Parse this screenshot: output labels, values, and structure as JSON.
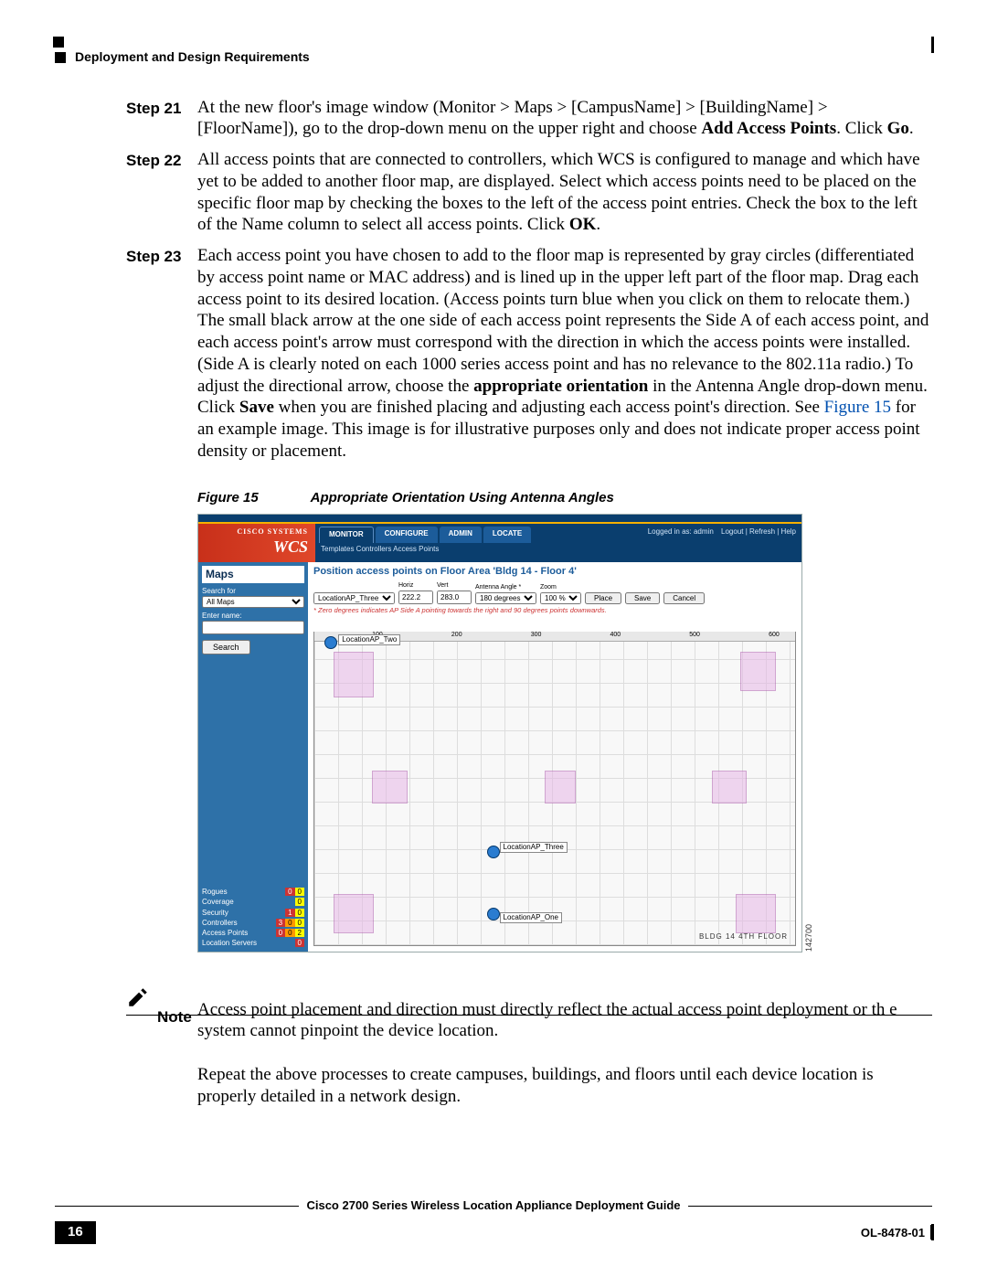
{
  "header": {
    "section": "Deployment and Design Requirements"
  },
  "steps": [
    {
      "label": "Step 21",
      "body_html": "At the new floor's image window (Monitor > Maps > [CampusName] > [BuildingName] > [FloorName]), go to the drop-down menu on the upper right and choose <b class='sans'>Add Access Points</b>. Click <b class='sans'>Go</b>."
    },
    {
      "label": "Step 22",
      "body_html": "All access points that are connected to controllers, which WCS is configured to manage and which have yet to be added to another floor map, are displayed. Select which access points need to be placed on the specific floor map by checking the boxes to the left of the access point entries. Check the box to the left of the Name column to select all access points. Click <b class='sans'>OK</b>."
    },
    {
      "label": "Step 23",
      "body_html": "Each access point you have chosen to add to the floor map is represented by gray circles (differentiated by access point name or MAC address) and is lined up in the upper left part of the floor map. Drag each access point to its desired location. (Access points turn blue when you click on them to relocate them.) The small black arrow at the one side of each access point represents the Side A of each access point, and each access point's arrow must correspond with the direction in which the access points were installed. (Side A is clearly noted on each 1000 series access point and has no relevance to the 802.11a radio.) To adjust the directional arrow, choose the <b class='sans'>appropriate orientation</b> in the Antenna Angle drop-down menu. Click <b class='sans'>Save</b> when you are finished placing and adjusting each access point's direction. See <a class='figref' href='#'>Figure 15</a> for an example image. This image is for illustrative purposes only and does not indicate proper access point density or placement."
    }
  ],
  "figure": {
    "num": "Figure 15",
    "title": "Appropriate Orientation Using Antenna Angles",
    "image_number": "142700"
  },
  "wcs": {
    "brand": "WCS",
    "tabs": [
      "MONITOR",
      "CONFIGURE",
      "ADMIN",
      "LOCATE"
    ],
    "subtabs": "Templates   Controllers   Access Points",
    "logged_in_as": "Logged in as: admin",
    "top_links": "Logout | Refresh | Help",
    "side": {
      "panel_title": "Maps",
      "search_for_label": "Search for",
      "search_for_value": "All Maps",
      "enter_name_label": "Enter name:",
      "search_button": "Search",
      "status": {
        "Rogues": [
          "0",
          "",
          "0"
        ],
        "Coverage": [
          "",
          "",
          "0"
        ],
        "Security": [
          "1",
          "",
          "0"
        ],
        "Controllers": [
          "3",
          "0",
          "0"
        ],
        "Access Points": [
          "0",
          "0",
          "2"
        ],
        "Location Servers": [
          "0",
          "",
          ""
        ]
      }
    },
    "main": {
      "title": "Position access points on Floor Area 'Bldg 14 - Floor 4'",
      "columns": {
        "ap_select": "LocationAP_Three",
        "horiz_label": "Horiz",
        "horiz": "222.2",
        "vert_label": "Vert",
        "vert": "283.0",
        "angle_label": "Antenna Angle *",
        "angle": "180 degrees",
        "zoom_label": "Zoom",
        "zoom": "100 %"
      },
      "buttons": {
        "place": "Place",
        "save": "Save",
        "cancel": "Cancel"
      },
      "hint": "* Zero degrees indicates AP Side A pointing towards the right and 90 degrees points downwards.",
      "ruler": [
        "100",
        "200",
        "300",
        "400",
        "500",
        "600"
      ],
      "aps": [
        "LocationAP_Two",
        "LocationAP_Three",
        "LocationAP_One"
      ],
      "bldg_label": "BLDG 14 4TH FLOOR"
    }
  },
  "note": {
    "label": "Note",
    "body": "Access point placement and direction must directly reflect the actual access point deployment or th e system cannot pinpoint the device location."
  },
  "post_note": "Repeat the above processes to create campuses, buildings, and floors until each device location is properly detailed in a network design.",
  "footer": {
    "title": "Cisco 2700 Series Wireless Location Appliance Deployment Guide",
    "page": "16",
    "doc_id": "OL-8478-01"
  }
}
